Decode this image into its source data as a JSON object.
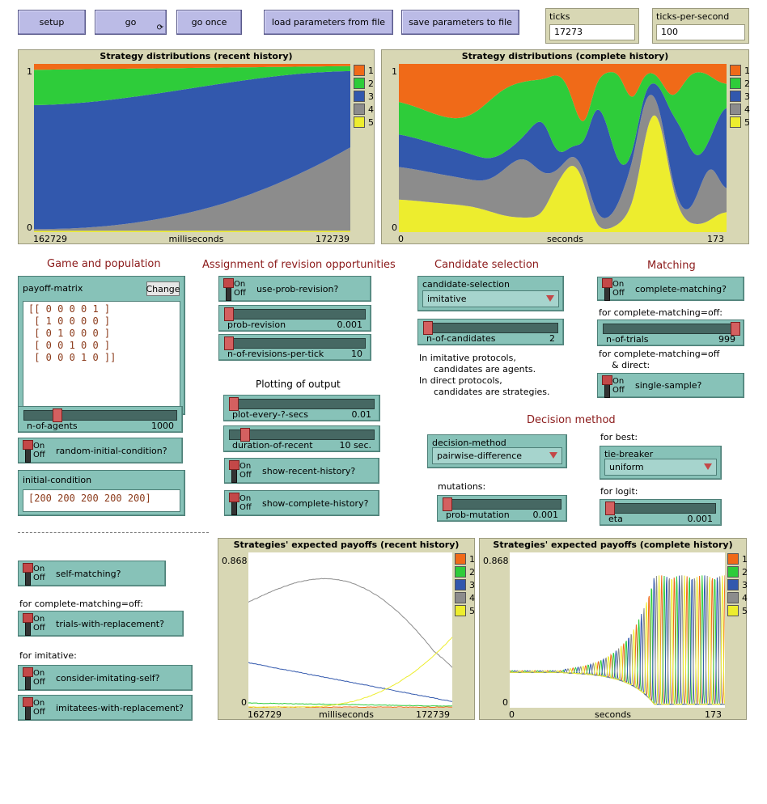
{
  "buttons": {
    "setup": "setup",
    "go": "go",
    "go_forever_symbol": "⟳",
    "go_once": "go once",
    "load": "load parameters from file",
    "save": "save parameters to file"
  },
  "monitors": {
    "ticks": {
      "label": "ticks",
      "value": "17273"
    },
    "tps": {
      "label": "ticks-per-second",
      "value": "100"
    }
  },
  "colors": {
    "s1": "#f06a18",
    "s2": "#2ecc3a",
    "s3": "#3258ad",
    "s4": "#8c8c8c",
    "s5": "#eded2e"
  },
  "dist_recent": {
    "title": "Strategy distributions (recent history)",
    "ymax_label": "1",
    "ymin_label": "0",
    "xmin_label": "162729",
    "xmax_label": "172739",
    "xlabel": "milliseconds",
    "legend": [
      "1",
      "2",
      "3",
      "4",
      "5"
    ]
  },
  "dist_complete": {
    "title": "Strategy distributions (complete history)",
    "ymax_label": "1",
    "ymin_label": "0",
    "xmin_label": "0",
    "xmax_label": "173",
    "xlabel": "seconds",
    "legend": [
      "1",
      "2",
      "3",
      "4",
      "5"
    ]
  },
  "pay_recent": {
    "title": "Strategies' expected payoffs (recent history)",
    "ymax_label": "0.868",
    "ymin_label": "0",
    "xmin_label": "162729",
    "xmax_label": "172739",
    "xlabel": "milliseconds",
    "legend": [
      "1",
      "2",
      "3",
      "4",
      "5"
    ]
  },
  "pay_complete": {
    "title": "Strategies' expected payoffs (complete history)",
    "ymax_label": "0.868",
    "ymin_label": "0",
    "xmin_label": "0",
    "xmax_label": "173",
    "xlabel": "seconds",
    "legend": [
      "1",
      "2",
      "3",
      "4",
      "5"
    ]
  },
  "headings": {
    "game": "Game and population",
    "assignment": "Assignment of revision opportunities",
    "candidate": "Candidate selection",
    "matching": "Matching",
    "plotting": "Plotting of output",
    "decision": "Decision method"
  },
  "payoff_matrix": {
    "label": "payoff-matrix",
    "change": "Change",
    "rows": [
      "[[ 0 0 0 0 1 ]",
      " [ 1 0 0 0 0 ]",
      " [ 0 1 0 0 0 ]",
      " [ 0 0 1 0 0 ]",
      " [ 0 0 0 1 0 ]]"
    ]
  },
  "switch_text": {
    "on": "On",
    "off": "Off"
  },
  "switches": {
    "use_prob_revision": "use-prob-revision?",
    "complete_matching": "complete-matching?",
    "single_sample": "single-sample?",
    "random_initial": "random-initial-condition?",
    "show_recent": "show-recent-history?",
    "show_complete": "show-complete-history?",
    "self_matching": "self-matching?",
    "trials_replacement": "trials-with-replacement?",
    "consider_self": "consider-imitating-self?",
    "imitatees_replacement": "imitatees-with-replacement?"
  },
  "sliders": {
    "prob_revision": {
      "name": "prob-revision",
      "value": "0.001",
      "position": 0.0
    },
    "n_revisions": {
      "name": "n-of-revisions-per-tick",
      "value": "10",
      "position": 0.0
    },
    "n_candidates": {
      "name": "n-of-candidates",
      "value": "2",
      "position": 0.0
    },
    "n_trials": {
      "name": "n-of-trials",
      "value": "999",
      "position": 1.0
    },
    "n_agents": {
      "name": "n-of-agents",
      "value": "1000",
      "position": 0.2
    },
    "plot_every": {
      "name": "plot-every-?-secs",
      "value": "0.01",
      "position": 0.0
    },
    "duration_recent": {
      "name": "duration-of-recent",
      "value": "10 sec.",
      "position": 0.08
    },
    "prob_mutation": {
      "name": "prob-mutation",
      "value": "0.001",
      "position": 0.0
    },
    "eta": {
      "name": "eta",
      "value": "0.001",
      "position": 0.0
    }
  },
  "choosers": {
    "candidate_selection": {
      "name": "candidate-selection",
      "value": "imitative"
    },
    "decision_method": {
      "name": "decision-method",
      "value": "pairwise-difference"
    },
    "tie_breaker": {
      "name": "tie-breaker",
      "value": "uniform"
    }
  },
  "input": {
    "label": "initial-condition",
    "value": "[200 200 200 200 200]"
  },
  "notes": {
    "complete_matching_off": "for complete-matching=off:",
    "complete_matching_off_direct_1": "for complete-matching=off",
    "complete_matching_off_direct_2": "& direct:",
    "imitative_protocols_1": "In imitative protocols,",
    "imitative_protocols_2": "candidates are agents.",
    "direct_protocols_1": "In direct protocols,",
    "direct_protocols_2": "candidates are strategies.",
    "mutations": "mutations:",
    "for_best": "for best:",
    "for_logit": "for logit:",
    "complete_matching_off_2": "for complete-matching=off:",
    "for_imitative": "for imitative:",
    "separator": "-------------------------------------------"
  }
}
